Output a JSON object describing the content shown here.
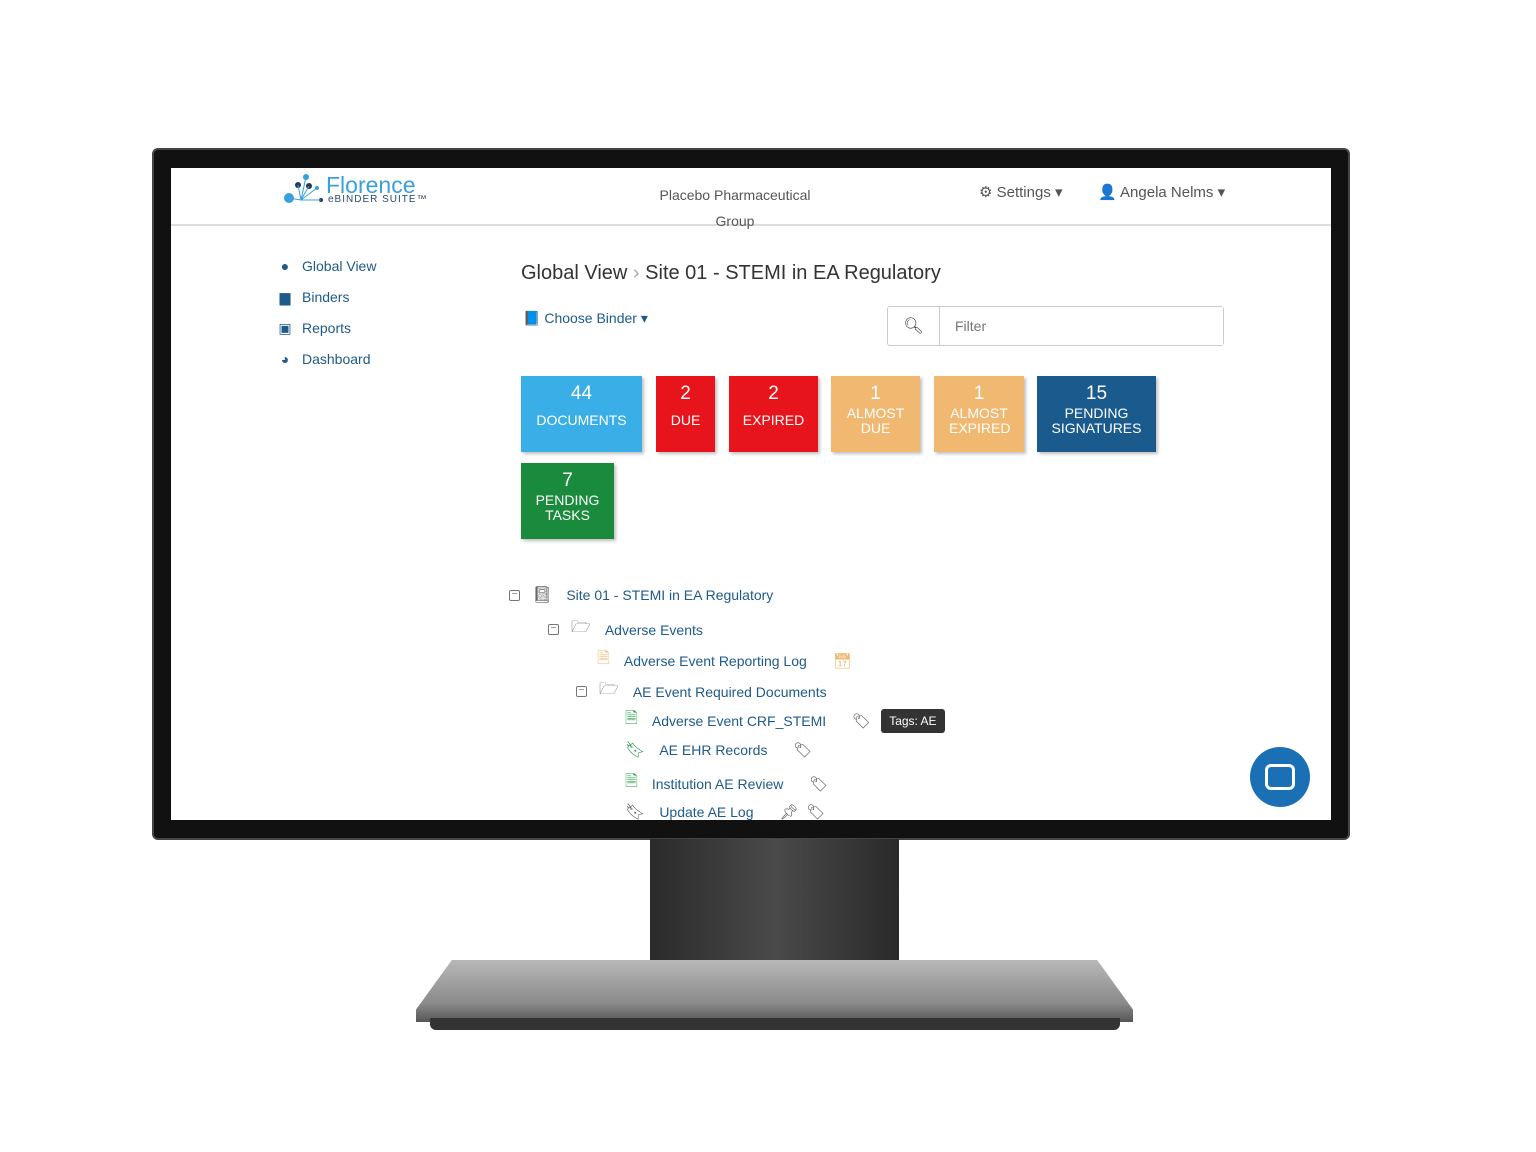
{
  "header": {
    "logo": "Florence",
    "logo_sub": "eBINDER SUITE™",
    "org": "Placebo Pharmaceutical Group",
    "settings": "Settings",
    "user": "Angela Nelms"
  },
  "sidebar": {
    "items": [
      {
        "label": "Global View",
        "icon": "globe-icon"
      },
      {
        "label": "Binders",
        "icon": "archive-icon"
      },
      {
        "label": "Reports",
        "icon": "report-icon"
      },
      {
        "label": "Dashboard",
        "icon": "dashboard-icon"
      }
    ]
  },
  "breadcrumb": {
    "root": "Global View",
    "current": "Site 01 - STEMI in EA Regulatory"
  },
  "choose_binder": "Choose Binder",
  "filter": {
    "placeholder": "Filter"
  },
  "tiles": [
    {
      "count": "44",
      "label": "DOCUMENTS",
      "color": "#3aaee6"
    },
    {
      "count": "2",
      "label": "DUE",
      "color": "#e8141b"
    },
    {
      "count": "2",
      "label": "EXPIRED",
      "color": "#e8141b"
    },
    {
      "count": "1",
      "label": "ALMOST DUE",
      "color": "#f0b870"
    },
    {
      "count": "1",
      "label": "ALMOST EXPIRED",
      "color": "#f0b870"
    },
    {
      "count": "15",
      "label": "PENDING SIGNATURES",
      "color": "#1a5a8c"
    },
    {
      "count": "7",
      "label": "PENDING TASKS",
      "color": "#1a8a3c"
    }
  ],
  "tree": [
    {
      "label": "Site 01 - STEMI in EA Regulatory",
      "icon": "binder-icon"
    },
    {
      "label": "Adverse Events",
      "icon": "folder-open-icon"
    },
    {
      "label": "Adverse Event Reporting Log",
      "icon": "pdf-icon"
    },
    {
      "label": "AE Event Required Documents",
      "icon": "folder-open-icon"
    },
    {
      "label": "Adverse Event CRF_STEMI",
      "icon": "pdf-icon",
      "tooltip": "Tags: AE"
    },
    {
      "label": "AE EHR Records",
      "icon": "bookmark-icon"
    },
    {
      "label": "Institution AE Review",
      "icon": "pdf-icon"
    },
    {
      "label": "Update AE Log",
      "icon": "bookmark-icon"
    }
  ]
}
